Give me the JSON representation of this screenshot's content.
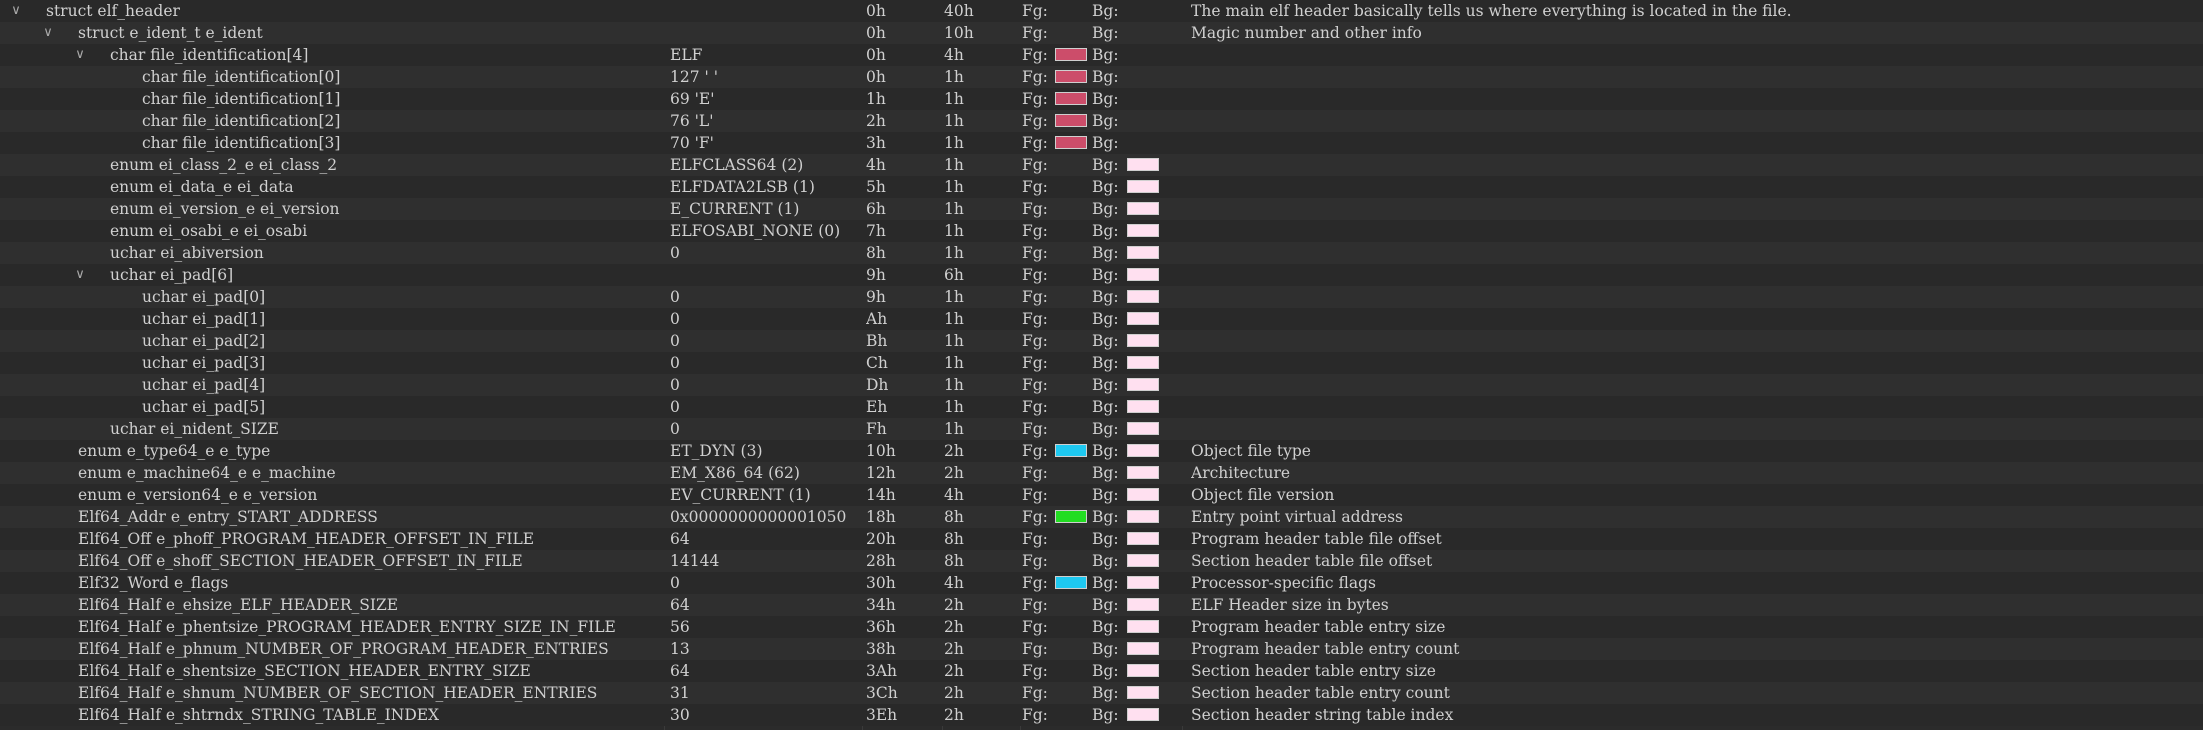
{
  "colors": {
    "red": "#cc4d6a",
    "pink": "#ffe0f0",
    "cyan": "#1ec8f0",
    "green": "#22dd22"
  },
  "labels": {
    "fg": "Fg:",
    "bg": "Bg:"
  },
  "rows": [
    {
      "name": "struct elf_header",
      "indent": 0,
      "expander": true,
      "value": "",
      "start": "0h",
      "size": "40h",
      "fg": null,
      "bg": null,
      "comment": "The main elf header basically tells us where everything is located in the file."
    },
    {
      "name": "struct e_ident_t e_ident",
      "indent": 1,
      "expander": true,
      "value": "",
      "start": "0h",
      "size": "10h",
      "fg": null,
      "bg": null,
      "comment": "Magic number and other info"
    },
    {
      "name": "char file_identification[4]",
      "indent": 2,
      "expander": true,
      "value": " ELF",
      "start": "0h",
      "size": "4h",
      "fg": "red",
      "bg": null,
      "comment": ""
    },
    {
      "name": "char file_identification[0]",
      "indent": 3,
      "expander": false,
      "value": "127 ' '",
      "start": "0h",
      "size": "1h",
      "fg": "red",
      "bg": null,
      "comment": ""
    },
    {
      "name": "char file_identification[1]",
      "indent": 3,
      "expander": false,
      "value": "69 'E'",
      "start": "1h",
      "size": "1h",
      "fg": "red",
      "bg": null,
      "comment": ""
    },
    {
      "name": "char file_identification[2]",
      "indent": 3,
      "expander": false,
      "value": "76 'L'",
      "start": "2h",
      "size": "1h",
      "fg": "red",
      "bg": null,
      "comment": ""
    },
    {
      "name": "char file_identification[3]",
      "indent": 3,
      "expander": false,
      "value": "70 'F'",
      "start": "3h",
      "size": "1h",
      "fg": "red",
      "bg": null,
      "comment": ""
    },
    {
      "name": "enum ei_class_2_e ei_class_2",
      "indent": 2,
      "expander": false,
      "value": "ELFCLASS64 (2)",
      "start": "4h",
      "size": "1h",
      "fg": null,
      "bg": "pink",
      "comment": ""
    },
    {
      "name": "enum ei_data_e ei_data",
      "indent": 2,
      "expander": false,
      "value": "ELFDATA2LSB (1)",
      "start": "5h",
      "size": "1h",
      "fg": null,
      "bg": "pink",
      "comment": ""
    },
    {
      "name": "enum ei_version_e ei_version",
      "indent": 2,
      "expander": false,
      "value": "E_CURRENT (1)",
      "start": "6h",
      "size": "1h",
      "fg": null,
      "bg": "pink",
      "comment": ""
    },
    {
      "name": "enum ei_osabi_e ei_osabi",
      "indent": 2,
      "expander": false,
      "value": "ELFOSABI_NONE (0)",
      "start": "7h",
      "size": "1h",
      "fg": null,
      "bg": "pink",
      "comment": ""
    },
    {
      "name": "uchar ei_abiversion",
      "indent": 2,
      "expander": false,
      "value": "0",
      "start": "8h",
      "size": "1h",
      "fg": null,
      "bg": "pink",
      "comment": ""
    },
    {
      "name": "uchar ei_pad[6]",
      "indent": 2,
      "expander": true,
      "value": "",
      "start": "9h",
      "size": "6h",
      "fg": null,
      "bg": "pink",
      "comment": ""
    },
    {
      "name": "uchar ei_pad[0]",
      "indent": 3,
      "expander": false,
      "value": "0",
      "start": "9h",
      "size": "1h",
      "fg": null,
      "bg": "pink",
      "comment": ""
    },
    {
      "name": "uchar ei_pad[1]",
      "indent": 3,
      "expander": false,
      "value": "0",
      "start": "Ah",
      "size": "1h",
      "fg": null,
      "bg": "pink",
      "comment": ""
    },
    {
      "name": "uchar ei_pad[2]",
      "indent": 3,
      "expander": false,
      "value": "0",
      "start": "Bh",
      "size": "1h",
      "fg": null,
      "bg": "pink",
      "comment": ""
    },
    {
      "name": "uchar ei_pad[3]",
      "indent": 3,
      "expander": false,
      "value": "0",
      "start": "Ch",
      "size": "1h",
      "fg": null,
      "bg": "pink",
      "comment": ""
    },
    {
      "name": "uchar ei_pad[4]",
      "indent": 3,
      "expander": false,
      "value": "0",
      "start": "Dh",
      "size": "1h",
      "fg": null,
      "bg": "pink",
      "comment": ""
    },
    {
      "name": "uchar ei_pad[5]",
      "indent": 3,
      "expander": false,
      "value": "0",
      "start": "Eh",
      "size": "1h",
      "fg": null,
      "bg": "pink",
      "comment": ""
    },
    {
      "name": "uchar ei_nident_SIZE",
      "indent": 2,
      "expander": false,
      "value": "0",
      "start": "Fh",
      "size": "1h",
      "fg": null,
      "bg": "pink",
      "comment": ""
    },
    {
      "name": "enum e_type64_e e_type",
      "indent": 1,
      "expander": false,
      "value": "ET_DYN (3)",
      "start": "10h",
      "size": "2h",
      "fg": "cyan",
      "bg": "pink",
      "comment": "Object file type"
    },
    {
      "name": "enum e_machine64_e e_machine",
      "indent": 1,
      "expander": false,
      "value": "EM_X86_64 (62)",
      "start": "12h",
      "size": "2h",
      "fg": null,
      "bg": "pink",
      "comment": "Architecture"
    },
    {
      "name": "enum e_version64_e e_version",
      "indent": 1,
      "expander": false,
      "value": "EV_CURRENT (1)",
      "start": "14h",
      "size": "4h",
      "fg": null,
      "bg": "pink",
      "comment": "Object file version"
    },
    {
      "name": "Elf64_Addr e_entry_START_ADDRESS",
      "indent": 1,
      "expander": false,
      "value": "0x0000000000001050",
      "start": "18h",
      "size": "8h",
      "fg": "green",
      "bg": "pink",
      "comment": "Entry point virtual address"
    },
    {
      "name": "Elf64_Off e_phoff_PROGRAM_HEADER_OFFSET_IN_FILE",
      "indent": 1,
      "expander": false,
      "value": "64",
      "start": "20h",
      "size": "8h",
      "fg": null,
      "bg": "pink",
      "comment": "Program header table file offset"
    },
    {
      "name": "Elf64_Off e_shoff_SECTION_HEADER_OFFSET_IN_FILE",
      "indent": 1,
      "expander": false,
      "value": "14144",
      "start": "28h",
      "size": "8h",
      "fg": null,
      "bg": "pink",
      "comment": "Section header table file offset"
    },
    {
      "name": "Elf32_Word e_flags",
      "indent": 1,
      "expander": false,
      "value": "0",
      "start": "30h",
      "size": "4h",
      "fg": "cyan",
      "bg": "pink",
      "comment": "Processor-specific flags"
    },
    {
      "name": "Elf64_Half e_ehsize_ELF_HEADER_SIZE",
      "indent": 1,
      "expander": false,
      "value": "64",
      "start": "34h",
      "size": "2h",
      "fg": null,
      "bg": "pink",
      "comment": "ELF Header size in bytes"
    },
    {
      "name": "Elf64_Half e_phentsize_PROGRAM_HEADER_ENTRY_SIZE_IN_FILE",
      "indent": 1,
      "expander": false,
      "value": "56",
      "start": "36h",
      "size": "2h",
      "fg": null,
      "bg": "pink",
      "comment": "Program header table entry size"
    },
    {
      "name": "Elf64_Half e_phnum_NUMBER_OF_PROGRAM_HEADER_ENTRIES",
      "indent": 1,
      "expander": false,
      "value": "13",
      "start": "38h",
      "size": "2h",
      "fg": null,
      "bg": "pink",
      "comment": "Program header table entry count"
    },
    {
      "name": "Elf64_Half e_shentsize_SECTION_HEADER_ENTRY_SIZE",
      "indent": 1,
      "expander": false,
      "value": "64",
      "start": "3Ah",
      "size": "2h",
      "fg": null,
      "bg": "pink",
      "comment": "Section header table entry size"
    },
    {
      "name": "Elf64_Half e_shnum_NUMBER_OF_SECTION_HEADER_ENTRIES",
      "indent": 1,
      "expander": false,
      "value": "31",
      "start": "3Ch",
      "size": "2h",
      "fg": null,
      "bg": "pink",
      "comment": "Section header table entry count"
    },
    {
      "name": "Elf64_Half e_shtrndx_STRING_TABLE_INDEX",
      "indent": 1,
      "expander": false,
      "value": "30",
      "start": "3Eh",
      "size": "2h",
      "fg": null,
      "bg": "pink",
      "comment": "Section header string table index"
    }
  ]
}
